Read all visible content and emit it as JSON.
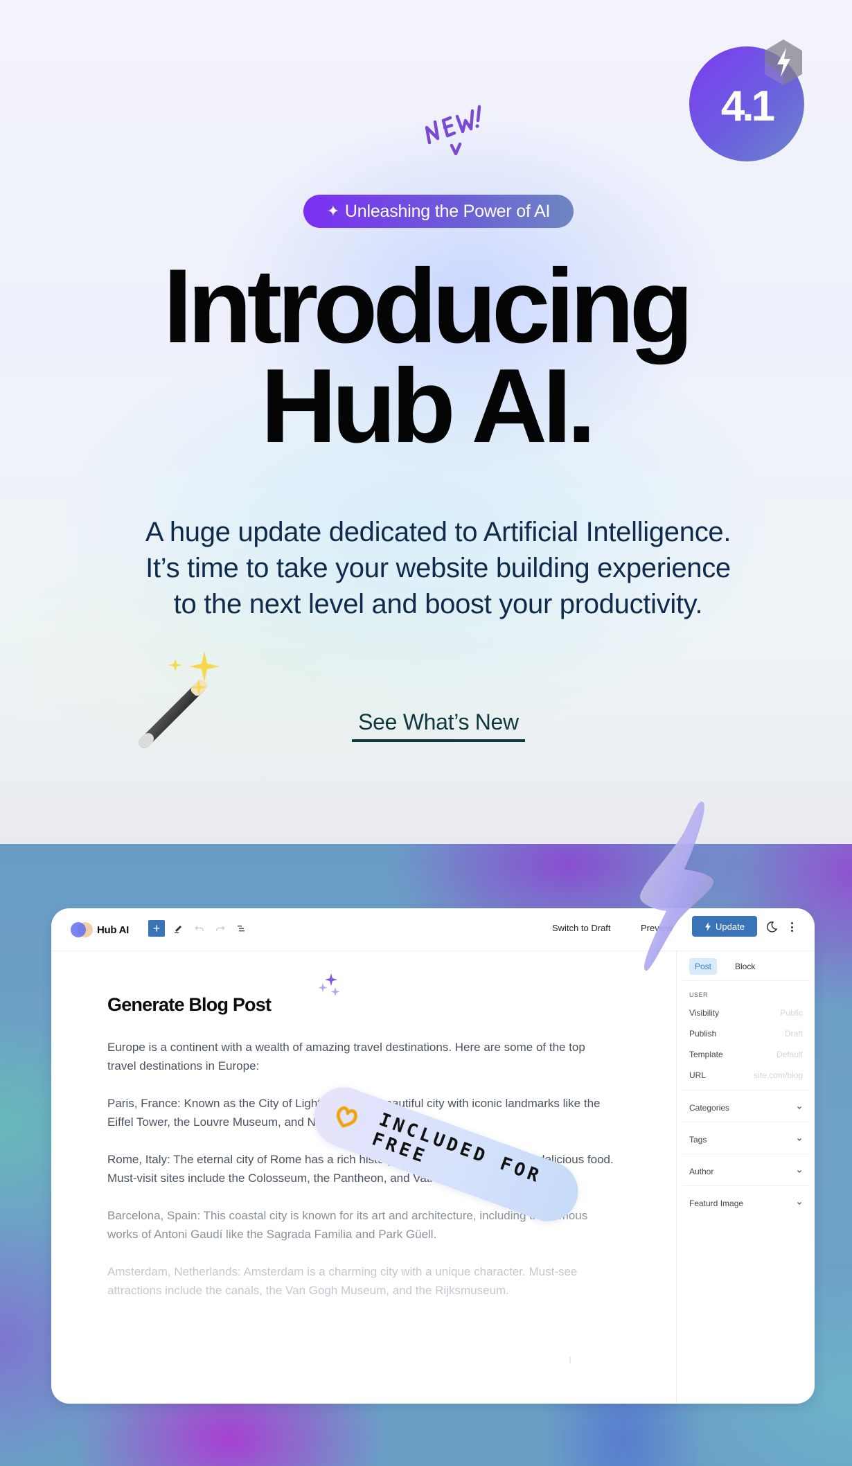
{
  "hero": {
    "new_label": "NEW!",
    "version": "4.1",
    "version_badge_icon": "lightning-bolt-icon",
    "pill_icon": "sparkle-icon",
    "pill_label": "Unleashing the Power of AI",
    "headline_line1": "Introducing",
    "headline_line2": "Hub AI.",
    "subtext": "A huge update dedicated to Artificial Intelligence. It’s time to take your website building experience to the next level and boost your productivity.",
    "cta_label": "See What’s New",
    "wand_icon": "magic-wand-icon"
  },
  "editor": {
    "app_name": "Hub AI",
    "toolbar": {
      "add_label": "+",
      "switch_draft_label": "Switch to Draft",
      "preview_label": "Preview",
      "update_label": "Update"
    },
    "post_title": "Generate Blog Post",
    "paragraphs": [
      "Europe is a continent with a wealth of amazing travel destinations. Here are some of the top travel destinations in Europe:",
      "Paris, France: Known as the City of Light, Paris is a beautiful city with iconic landmarks like the Eiffel Tower, the Louvre Museum, and Notre-Dame Cathedral.",
      "Rome, Italy: The eternal city of Rome has a rich history, stunning architecture, and delicious food. Must-visit sites include the Colosseum, the Pantheon, and Vatican City.",
      "Barcelona, Spain: This coastal city is known for its art and architecture, including the famous works of Antoni Gaudí like the Sagrada Familia and Park Güell.",
      "Amsterdam, Netherlands: Amsterdam is a charming city with a unique character. Must-see attractions include the canals, the Van Gogh Museum, and the Rijksmuseum."
    ],
    "sidebar": {
      "tabs": [
        {
          "label": "Post",
          "active": true
        },
        {
          "label": "Block",
          "active": false
        }
      ],
      "section_label": "USER",
      "rows": [
        {
          "key": "Visibility",
          "value": "Public"
        },
        {
          "key": "Publish",
          "value": "Draft"
        },
        {
          "key": "Template",
          "value": "Default"
        },
        {
          "key": "URL",
          "value": "site.com/blog"
        }
      ],
      "accordions": [
        "Categories",
        "Tags",
        "Author",
        "Featurd Image"
      ]
    }
  },
  "badge": {
    "label": "INCLUDED FOR FREE",
    "icon": "heart-hands-icon"
  },
  "colors": {
    "brand_purple": "#7b2ff2",
    "update_blue": "#3b73b9",
    "cta_teal": "#0e3a3f",
    "subtext_navy": "#0f2a4a"
  }
}
